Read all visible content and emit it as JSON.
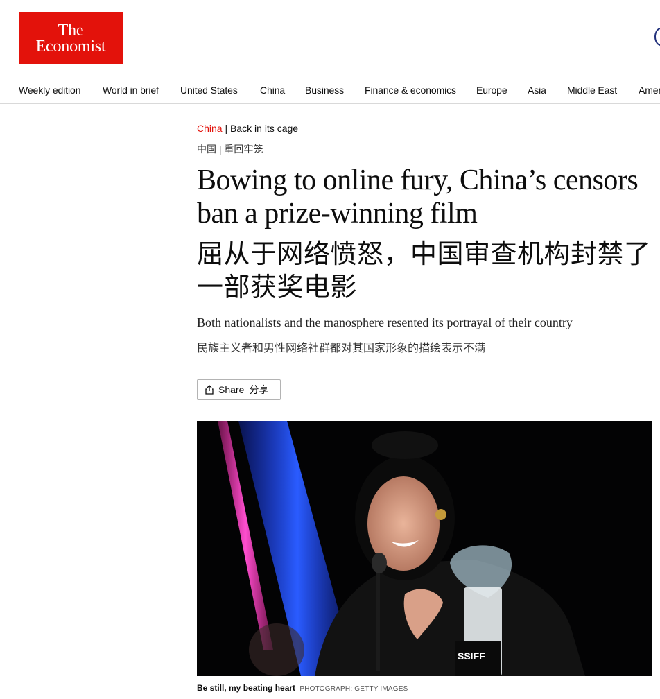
{
  "brand": {
    "line1": "The",
    "line2": "Economist",
    "color": "#e3120b"
  },
  "nav": {
    "items": [
      "Weekly edition",
      "World in brief",
      "United States",
      "China",
      "Business",
      "Finance & economics",
      "Europe",
      "Asia",
      "Middle East",
      "Amer"
    ]
  },
  "article": {
    "section": "China",
    "separator": " | ",
    "rubric": "Back in its cage",
    "section_zh": "中国",
    "rubric_zh": "重回牢笼",
    "headline": "Bowing to online fury, China’s censors ban a prize-winning film",
    "headline_zh": "屈从于网络愤怒，中国审查机构封禁了一部获奖电影",
    "standfirst": "Both nationalists and the manosphere resented its portrayal of their country",
    "standfirst_zh": "民族主义者和男性网络社群都对其国家形象的描绘表示不满",
    "share_label": "Share",
    "share_label_zh": "分享",
    "share_icon": "share-icon",
    "image": {
      "trophy_text": "SSIFF"
    },
    "caption": "Be still, my beating heart",
    "credit": "PHOTOGRAPH: GETTY IMAGES"
  }
}
